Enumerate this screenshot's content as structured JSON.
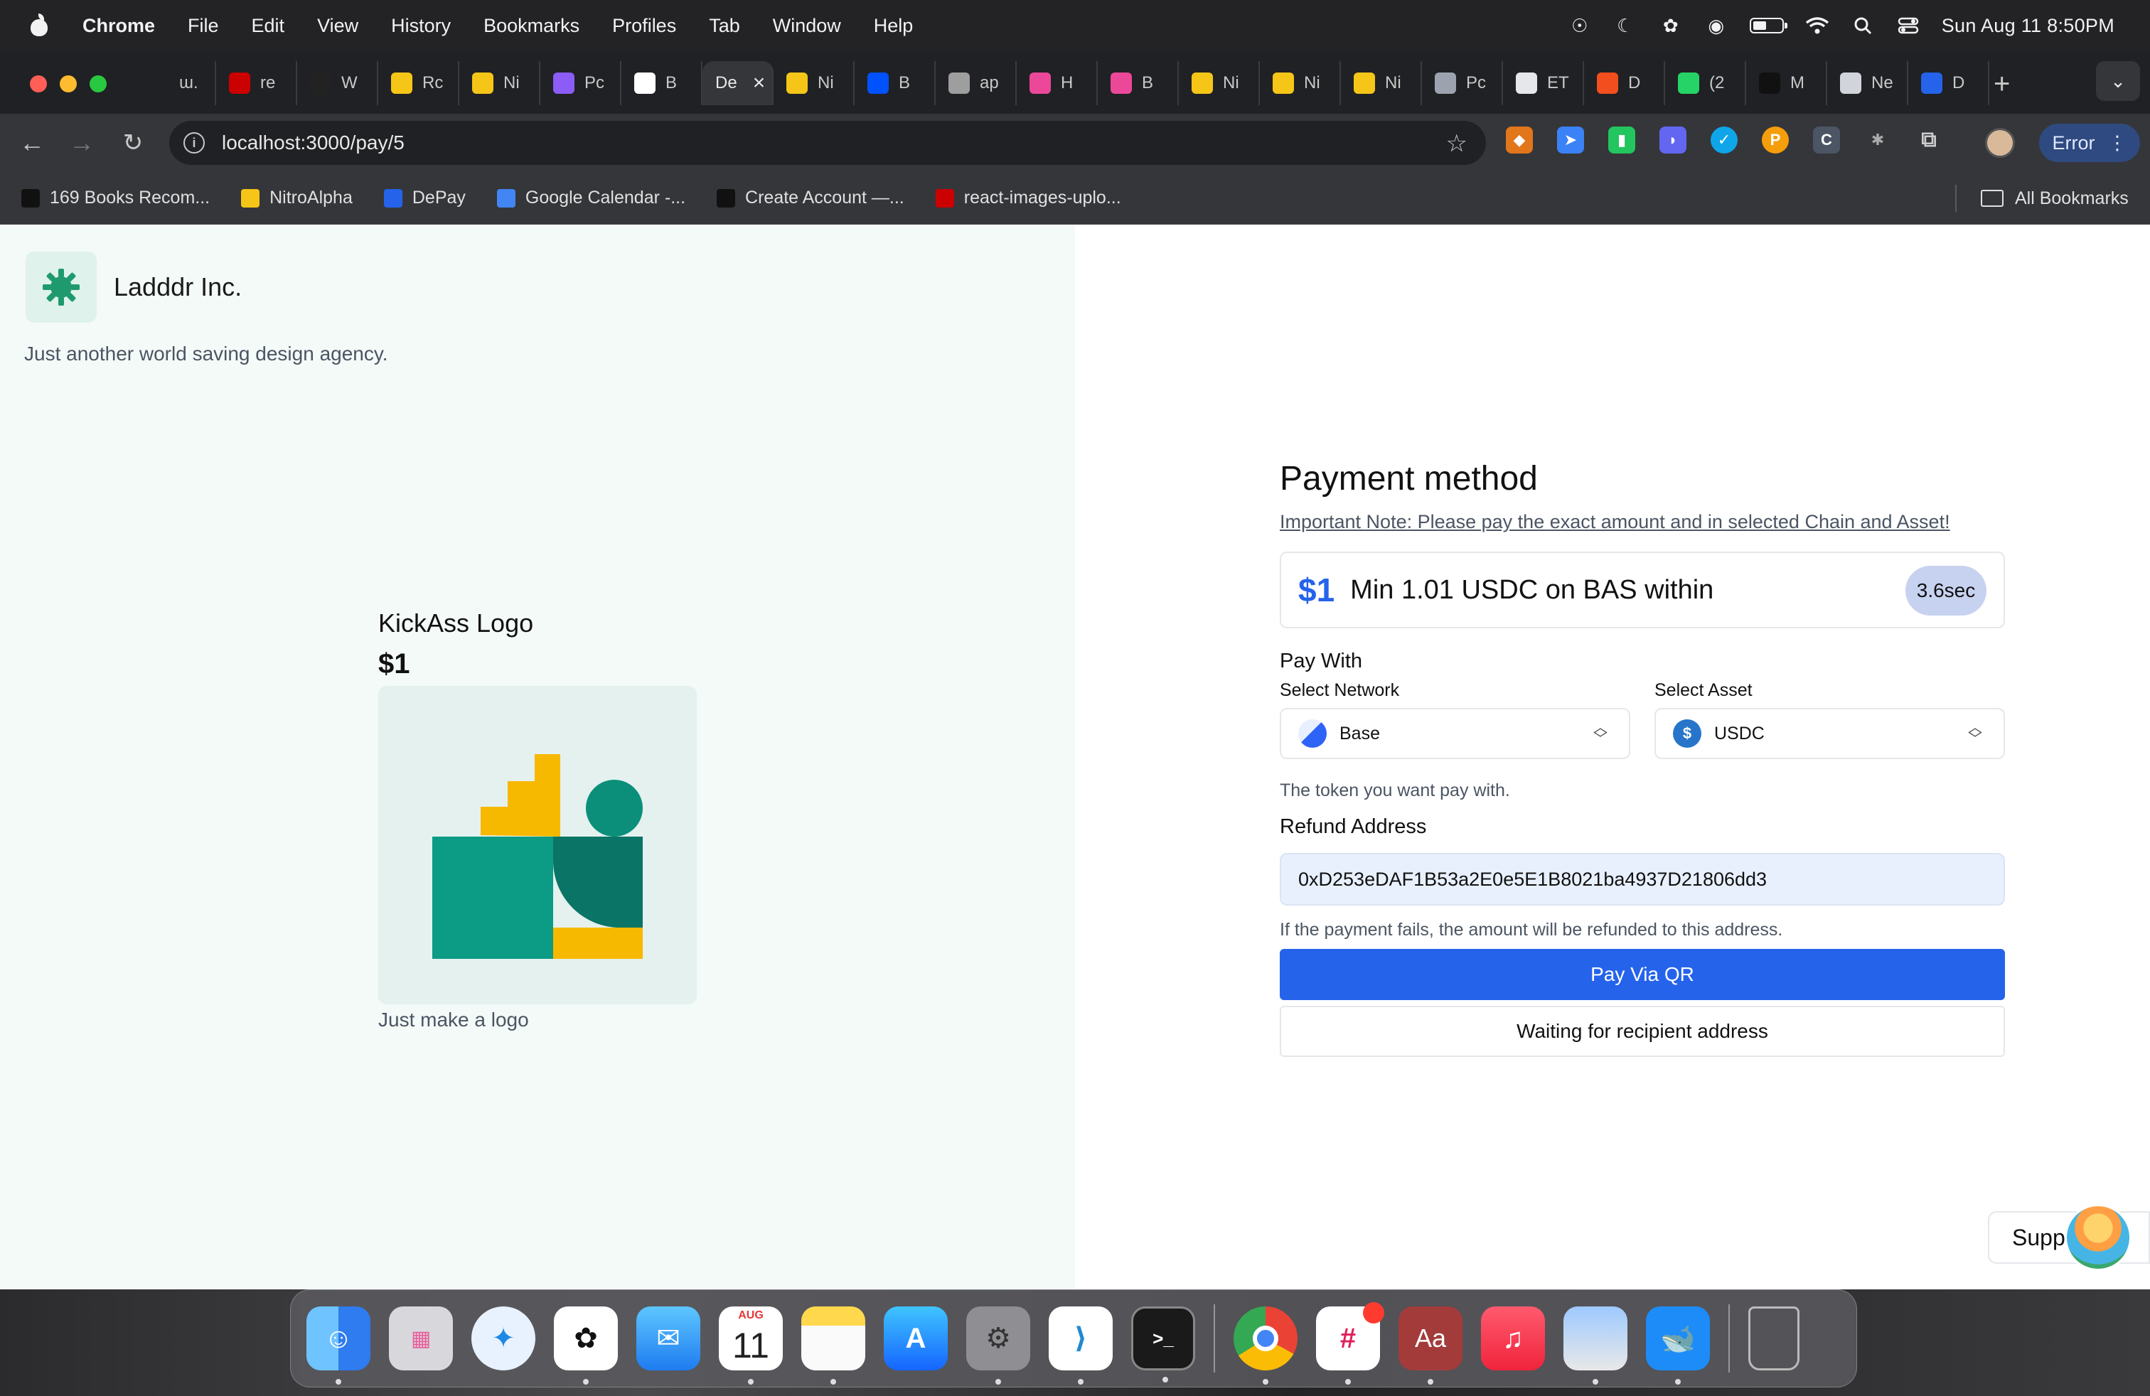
{
  "menubar": {
    "app_name": "Chrome",
    "menus": [
      "File",
      "Edit",
      "View",
      "History",
      "Bookmarks",
      "Profiles",
      "Tab",
      "Window",
      "Help"
    ],
    "clock": "Sun Aug 11  8:50PM"
  },
  "tabs": [
    {
      "label": "ɯ.",
      "icon": "ladder-icon",
      "color": "#202124"
    },
    {
      "label": "re",
      "icon": "npm-icon",
      "color": "#cb0000"
    },
    {
      "label": "W",
      "icon": "wallet-icon",
      "color": "#222222"
    },
    {
      "label": "Rc",
      "icon": "bolt-icon",
      "color": "#f5c518"
    },
    {
      "label": "Ni",
      "icon": "bolt-icon",
      "color": "#f5c518"
    },
    {
      "label": "Pc",
      "icon": "link-icon",
      "color": "#8b5cf6"
    },
    {
      "label": "B",
      "icon": "chart-icon",
      "color": "#ffffff"
    },
    {
      "label": "De",
      "icon": "",
      "color": "#35363a",
      "active": true
    },
    {
      "label": "Ni",
      "icon": "bolt-icon",
      "color": "#f5c518"
    },
    {
      "label": "B",
      "icon": "base-icon",
      "color": "#0052ff"
    },
    {
      "label": "ap",
      "icon": "globe-icon",
      "color": "#9e9e9e"
    },
    {
      "label": "H",
      "icon": "framer-icon",
      "color": "#ec4899"
    },
    {
      "label": "B",
      "icon": "framer-icon",
      "color": "#ec4899"
    },
    {
      "label": "Ni",
      "icon": "bolt-icon",
      "color": "#f5c518"
    },
    {
      "label": "Ni",
      "icon": "bolt-icon",
      "color": "#f5c518"
    },
    {
      "label": "Ni",
      "icon": "bolt-icon",
      "color": "#f5c518"
    },
    {
      "label": "Pc",
      "icon": "eyes-icon",
      "color": "#9ca3af"
    },
    {
      "label": "ET",
      "icon": "eth-icon",
      "color": "#e5e7eb"
    },
    {
      "label": "D",
      "icon": "figma-icon",
      "color": "#f24e1e"
    },
    {
      "label": "(2",
      "icon": "whatsapp-icon",
      "color": "#25d366"
    },
    {
      "label": "M",
      "icon": "arc-icon",
      "color": "#111111"
    },
    {
      "label": "Ne",
      "icon": "openai-icon",
      "color": "#d1d5db"
    },
    {
      "label": "D",
      "icon": "depay-icon",
      "color": "#2563eb"
    }
  ],
  "toolbar": {
    "url": "localhost:3000/pay/5",
    "error_label": "Error"
  },
  "bookmarks": [
    {
      "label": "169 Books Recom...",
      "icon": "book-icon",
      "color": "#111111"
    },
    {
      "label": "NitroAlpha",
      "icon": "bolt-icon",
      "color": "#f5c518"
    },
    {
      "label": "DePay",
      "icon": "depay-icon",
      "color": "#2563eb"
    },
    {
      "label": "Google Calendar -...",
      "icon": "calendar-icon",
      "color": "#4285f4"
    },
    {
      "label": "Create Account —...",
      "icon": "d-icon",
      "color": "#111111"
    },
    {
      "label": "react-images-uplo...",
      "icon": "npm-icon",
      "color": "#cb0000"
    }
  ],
  "all_bookmarks_label": "All Bookmarks",
  "merchant": {
    "name": "Ladddr Inc.",
    "tagline": "Just another world saving design agency."
  },
  "product": {
    "title": "KickAss Logo",
    "price": "$1",
    "description": "Just make a logo"
  },
  "payment": {
    "title": "Payment method",
    "note": "Important Note: Please pay the exact amount and in selected Chain and Asset!",
    "amount_usd": "$1",
    "amount_text": "Min 1.01 USDC on BAS within",
    "timer": "3.6sec",
    "pay_with_label": "Pay With",
    "network_label": "Select Network",
    "network_value": "Base",
    "asset_label": "Select Asset",
    "asset_value": "USDC",
    "token_hint": "The token you want pay with.",
    "refund_label": "Refund Address",
    "refund_address": "0xD253eDAF1B53a2E0e5E1B8021ba4937D21806dd3",
    "refund_hint": "If the payment fails, the amount will be refunded to this address.",
    "pay_qr_button": "Pay Via QR",
    "waiting_button": "Waiting for recipient address"
  },
  "support_label": "Supp",
  "dock": {
    "calendar_month": "AUG",
    "calendar_day": "11",
    "apps": [
      "finder",
      "launchpad",
      "safari",
      "chatgpt",
      "mail",
      "calendar",
      "notes",
      "app-store",
      "system-settings",
      "vscode",
      "terminal",
      "chrome",
      "slack",
      "dictionary",
      "music",
      "preview",
      "docker",
      "trash"
    ]
  },
  "colors": {
    "accent": "#2563eb",
    "brand_green": "#0f9d7a",
    "left_panel_bg": "#f4faf8"
  }
}
